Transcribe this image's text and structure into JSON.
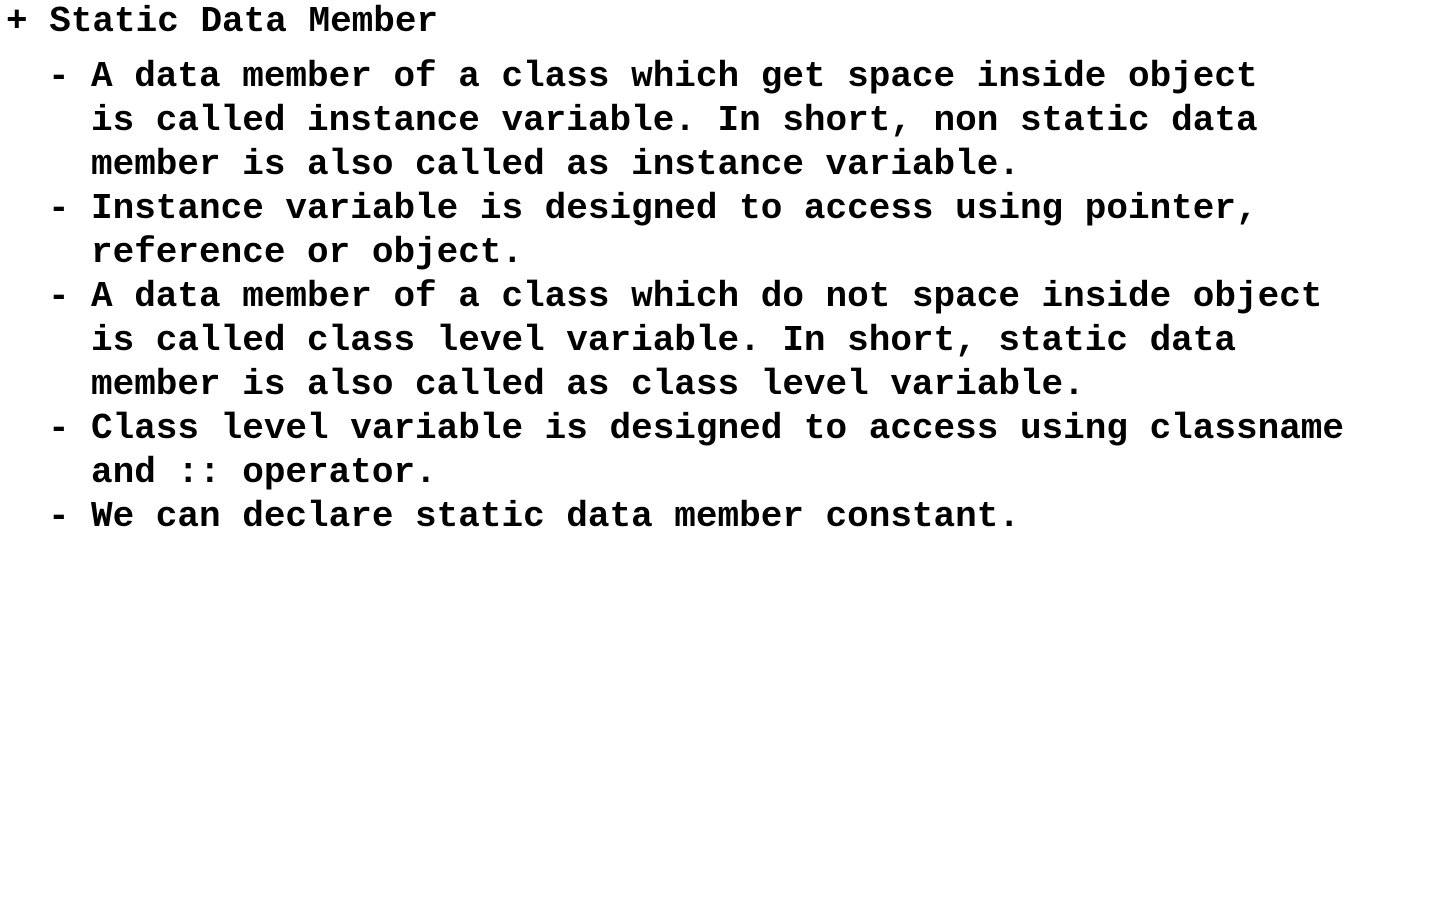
{
  "document": {
    "heading_marker": "+",
    "heading": "Static Data Member",
    "bullet_marker": "-",
    "items": [
      {
        "lines": [
          "A data member of a class which get space inside object",
          "is called instance variable. In short, non static data",
          "member is also called as instance variable."
        ]
      },
      {
        "lines": [
          "Instance variable is designed to access using pointer,",
          "reference or object."
        ]
      },
      {
        "lines": [
          "A data member of a class which do not space inside object",
          "is called class level variable. In short, static data",
          "member is also called as class level variable."
        ]
      },
      {
        "lines": [
          "Class level variable is designed to access using classname",
          "and :: operator."
        ]
      },
      {
        "lines": [
          "We can declare static data member constant."
        ]
      }
    ]
  }
}
